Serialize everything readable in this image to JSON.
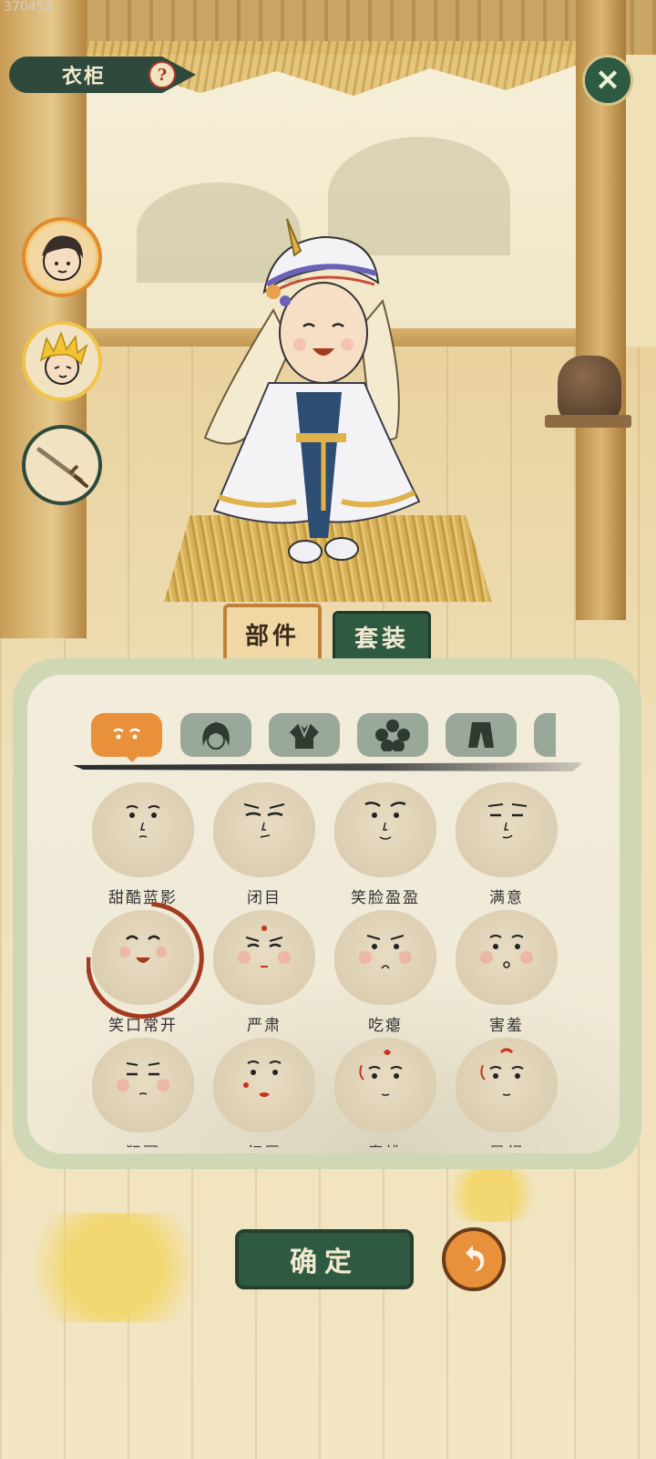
{
  "corner_id": "370453",
  "header": {
    "title": "衣柜",
    "help_glyph": "?",
    "close_glyph": "✕"
  },
  "side_buttons": [
    {
      "name": "character-a",
      "state": "active"
    },
    {
      "name": "character-b",
      "state": "normal"
    },
    {
      "name": "weapon",
      "state": "normal"
    }
  ],
  "tabs": [
    {
      "label": "部件",
      "active": true
    },
    {
      "label": "套装",
      "active": false
    }
  ],
  "categories": [
    {
      "icon": "face-icon",
      "active": true
    },
    {
      "icon": "hair-icon",
      "active": false
    },
    {
      "icon": "clothes-icon",
      "active": false
    },
    {
      "icon": "flower-icon",
      "active": false
    },
    {
      "icon": "pants-icon",
      "active": false
    },
    {
      "icon": "more-icon",
      "active": false
    }
  ],
  "faces": [
    {
      "label": "甜酷蓝影",
      "selected": false
    },
    {
      "label": "闭目",
      "selected": false
    },
    {
      "label": "笑脸盈盈",
      "selected": false
    },
    {
      "label": "满意",
      "selected": false
    },
    {
      "label": "笑口常开",
      "selected": true
    },
    {
      "label": "严肃",
      "selected": false
    },
    {
      "label": "吃瘪",
      "selected": false
    },
    {
      "label": "害羞",
      "selected": false
    },
    {
      "label": "犯困",
      "selected": false
    },
    {
      "label": "红唇",
      "selected": false
    },
    {
      "label": "春桃",
      "selected": false
    },
    {
      "label": "凤翎",
      "selected": false
    }
  ],
  "footer": {
    "confirm_label": "确定",
    "undo_icon": "undo-arrow-icon"
  },
  "colors": {
    "accent": "#e8903a",
    "primary": "#2f5a42",
    "selected_ring": "#a23b22"
  }
}
